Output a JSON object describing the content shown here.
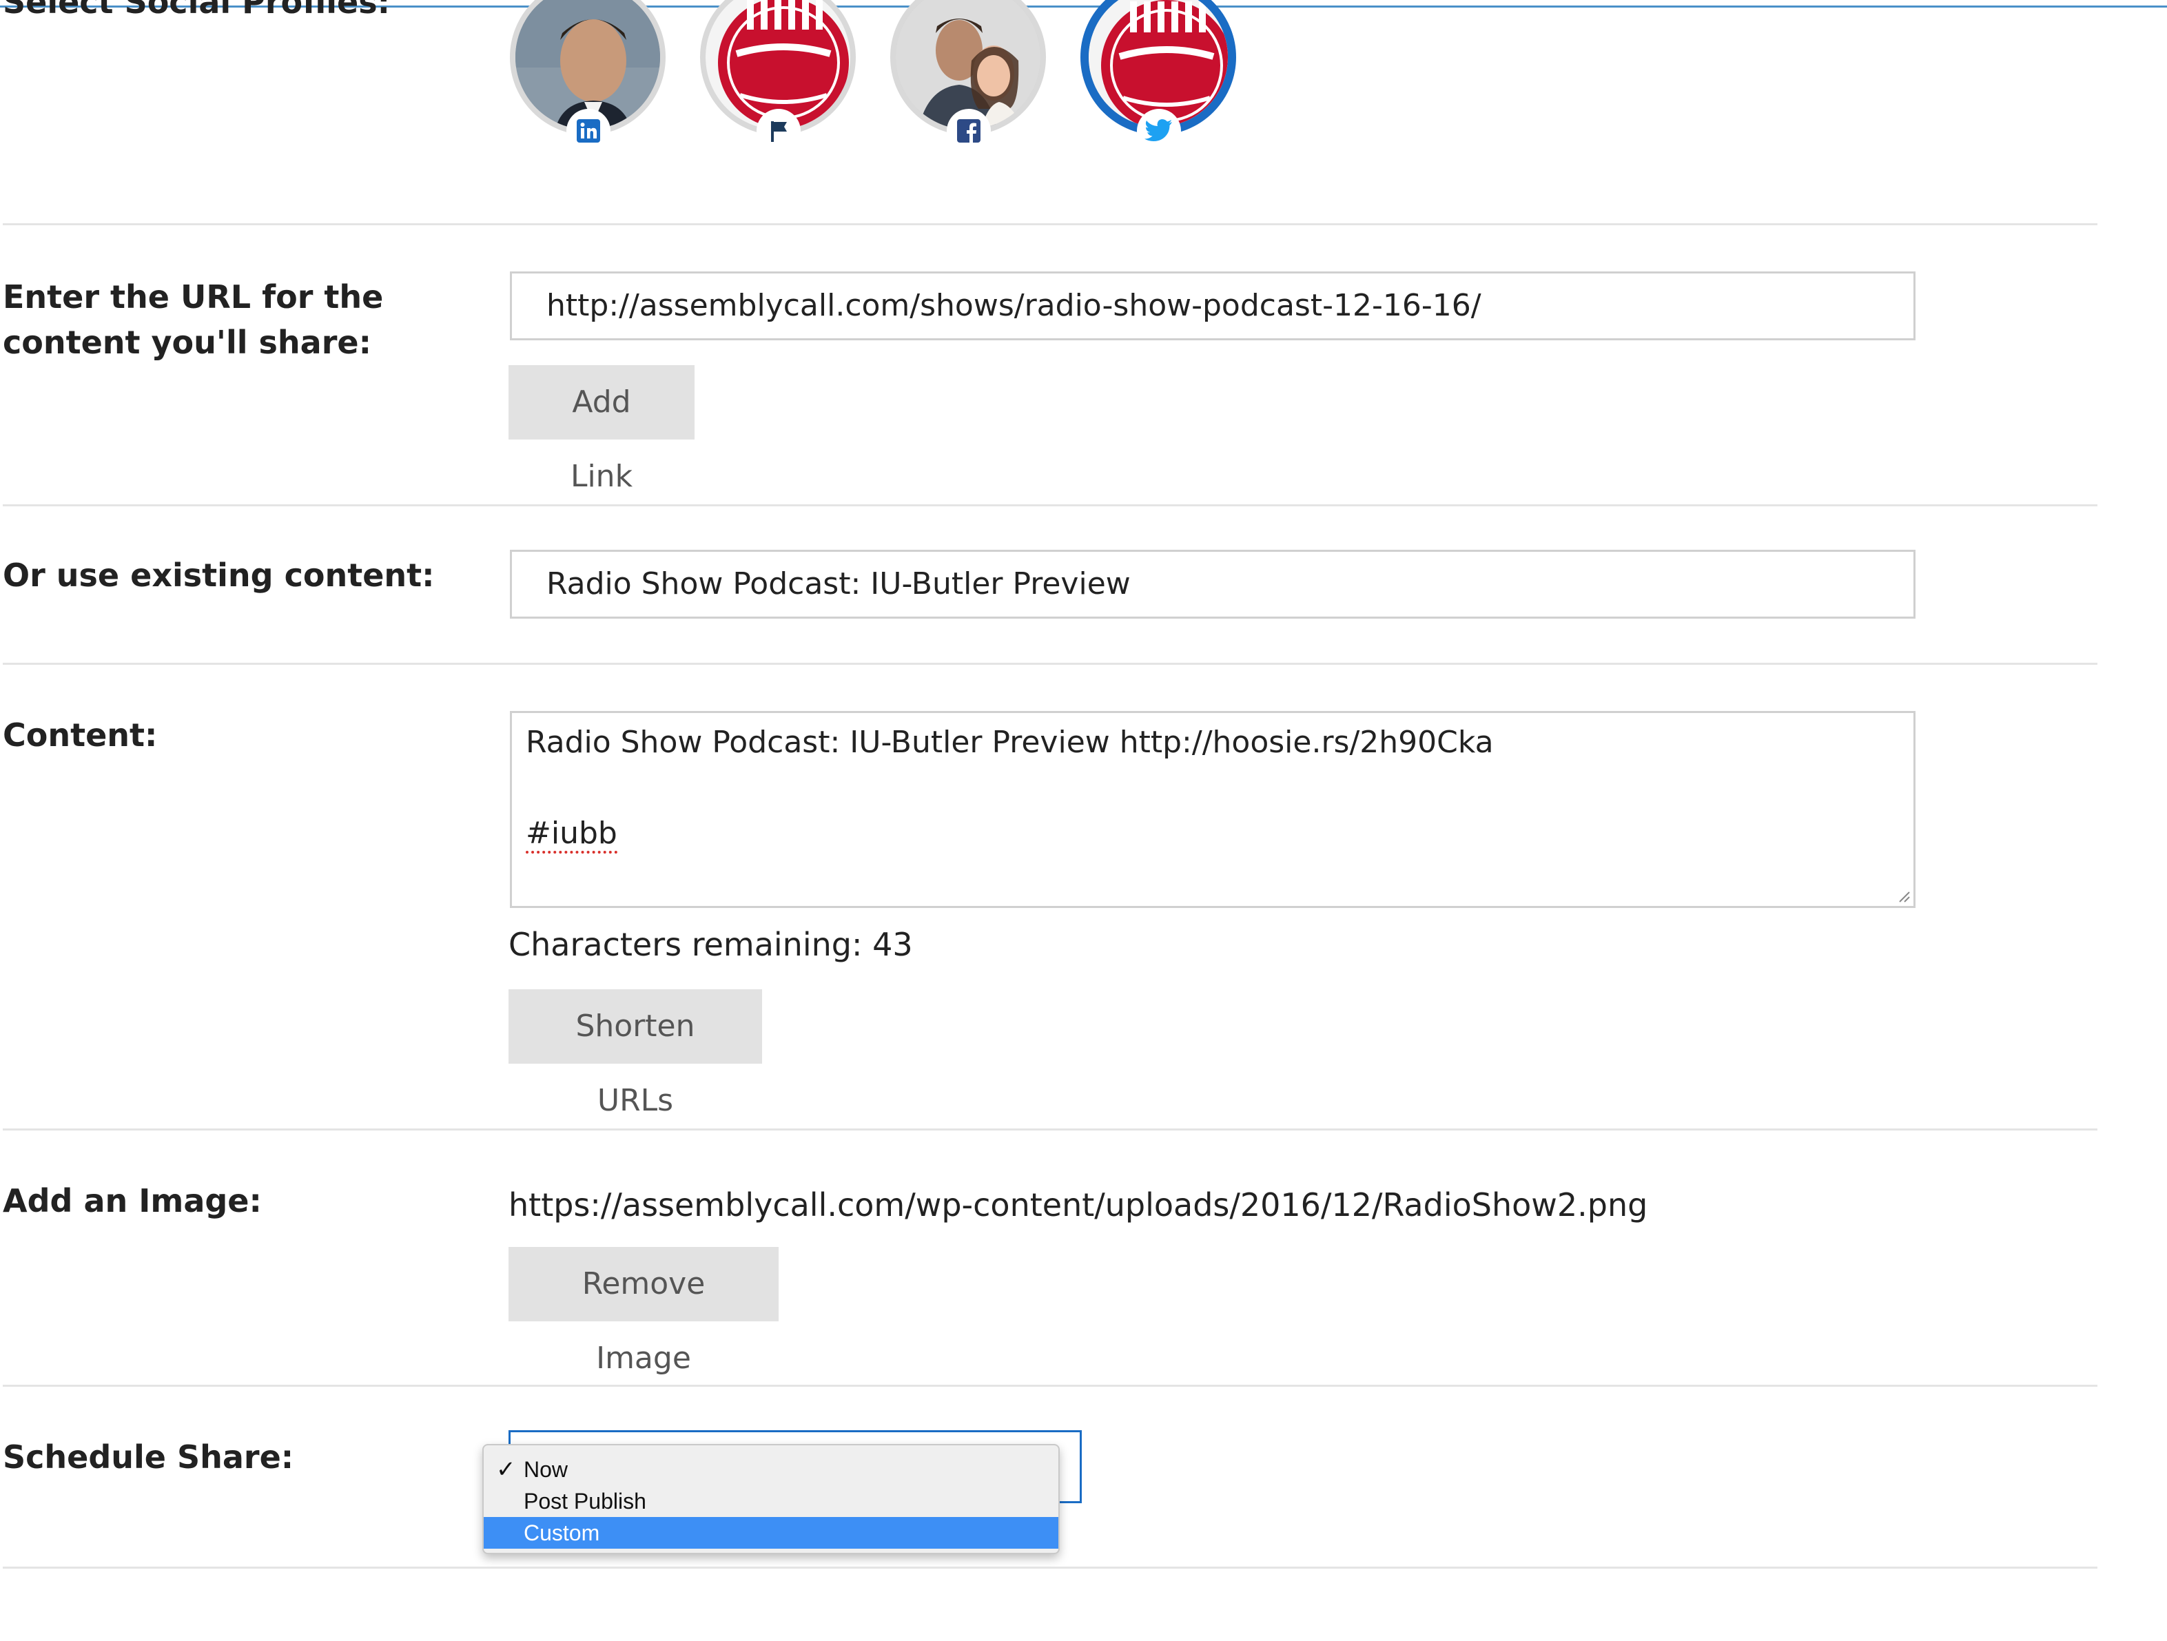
{
  "profiles": {
    "label": "Select Social Profiles:",
    "items": [
      {
        "network": "linkedin",
        "badge_icon": "linkedin-icon",
        "selected": false
      },
      {
        "network": "page",
        "badge_icon": "flag-icon",
        "selected": false
      },
      {
        "network": "facebook",
        "badge_icon": "facebook-icon",
        "selected": false
      },
      {
        "network": "twitter",
        "badge_icon": "twitter-icon",
        "selected": true
      }
    ]
  },
  "url_section": {
    "label_line1": "Enter the URL for the",
    "label_line2": "content you'll share:",
    "value": "http://assemblycall.com/shows/radio-show-podcast-12-16-16/",
    "button_label": "Add Link"
  },
  "existing_section": {
    "label": "Or use existing content:",
    "value": "Radio Show Podcast: IU-Butler Preview"
  },
  "content_section": {
    "label": "Content:",
    "line1": "Radio Show Podcast: IU-Butler Preview http://hoosie.rs/2h90Cka",
    "line2": "#iubb",
    "chars_remaining": "Characters remaining: 43",
    "button_label": "Shorten URLs"
  },
  "image_section": {
    "label": "Add an Image:",
    "url": "https://assemblycall.com/wp-content/uploads/2016/12/RadioShow2.png",
    "button_label": "Remove Image"
  },
  "schedule_section": {
    "label": "Schedule Share:",
    "options": [
      {
        "label": "Now",
        "checked": true,
        "highlighted": false
      },
      {
        "label": "Post Publish",
        "checked": false,
        "highlighted": false
      },
      {
        "label": "Custom",
        "checked": false,
        "highlighted": true
      }
    ]
  },
  "colors": {
    "accent": "#1a6cc4",
    "highlight": "#3d8ff5",
    "brand_red": "#c8102e"
  }
}
